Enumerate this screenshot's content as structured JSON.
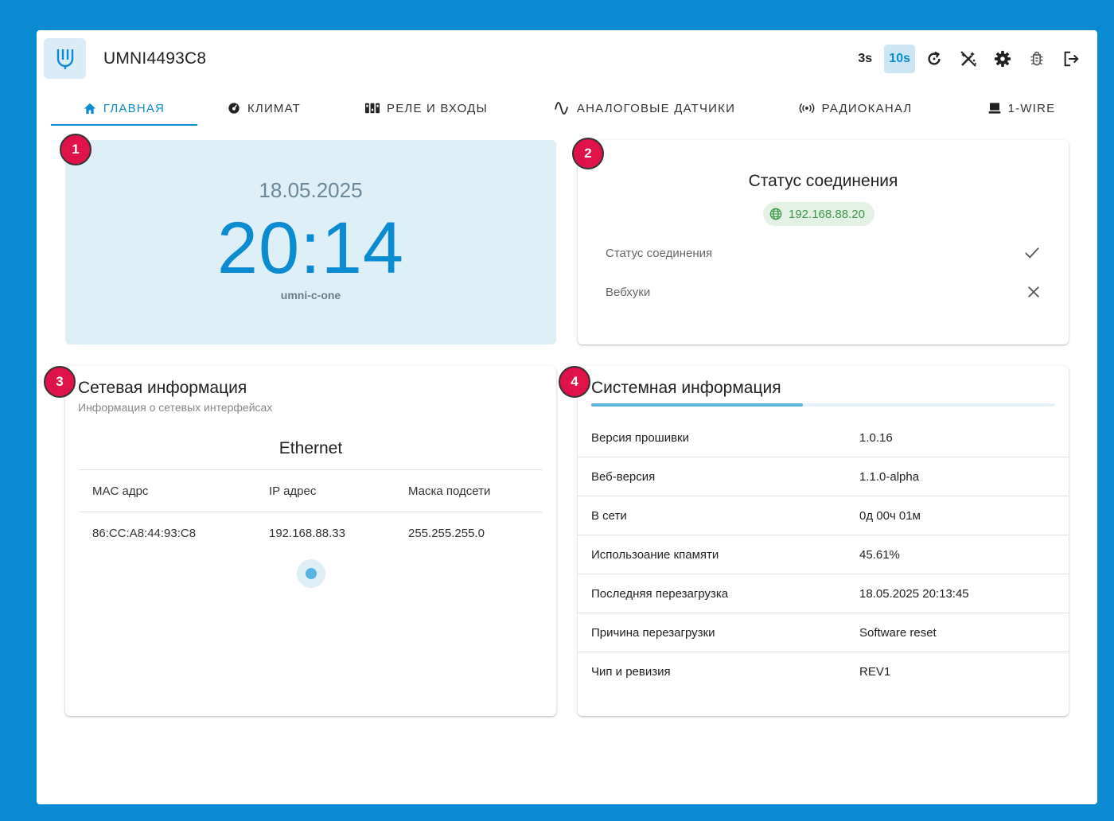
{
  "header": {
    "device_name": "UMNI4493C8",
    "refresh_3s": "3s",
    "refresh_10s": "10s",
    "icons": [
      "refresh-icon",
      "magic-wand-off-icon",
      "settings-gear-icon",
      "bug-icon",
      "logout-icon"
    ]
  },
  "tabs": [
    {
      "label": "ГЛАВНАЯ",
      "icon": "home-icon",
      "active": true
    },
    {
      "label": "КЛИМАТ",
      "icon": "gauge-icon"
    },
    {
      "label": "РЕЛЕ И ВХОДЫ",
      "icon": "relay-icon"
    },
    {
      "label": "АНАЛОГОВЫЕ ДАТЧИКИ",
      "icon": "sine-wave-icon"
    },
    {
      "label": "РАДИОКАНАЛ",
      "icon": "radio-signal-icon"
    },
    {
      "label": "1-WIRE",
      "icon": "computer-icon"
    }
  ],
  "badges": [
    "1",
    "2",
    "3",
    "4"
  ],
  "clock": {
    "date": "18.05.2025",
    "time": "20:14",
    "hostname": "umni-c-one"
  },
  "status": {
    "title": "Статус соединения",
    "ip": "192.168.88.20",
    "rows": [
      {
        "label": "Статус соединения",
        "state": "check-icon"
      },
      {
        "label": "Вебхуки",
        "state": "close-icon"
      }
    ]
  },
  "network": {
    "title": "Сетевая информация",
    "subtitle": "Информация о сетевых интерфейсах",
    "interface": "Ethernet",
    "headers": [
      "MAC адрс",
      "IP адрес",
      "Маска подсети"
    ],
    "rows": [
      [
        "86:CC:A8:44:93:C8",
        "192.168.88.33",
        "255.255.255.0"
      ]
    ]
  },
  "system": {
    "title": "Системная информация",
    "memory_usage_fraction": 0.4561,
    "rows": [
      {
        "key": "Версия прошивки",
        "value": "1.0.16"
      },
      {
        "key": "Веб-версия",
        "value": "1.1.0-alpha"
      },
      {
        "key": "В сети",
        "value": "0д 00ч 01м"
      },
      {
        "key": "Использоание кпамяти",
        "value": "45.61%"
      },
      {
        "key": "Последняя перезагрузка",
        "value": "18.05.2025 20:13:45"
      },
      {
        "key": "Причина перезагрузки",
        "value": "Software reset"
      },
      {
        "key": "Чип и ревизия",
        "value": "REV1"
      }
    ]
  },
  "colors": {
    "accent": "#0b8bd2",
    "badge": "#e0124a",
    "ok_green": "#3a9a47"
  }
}
